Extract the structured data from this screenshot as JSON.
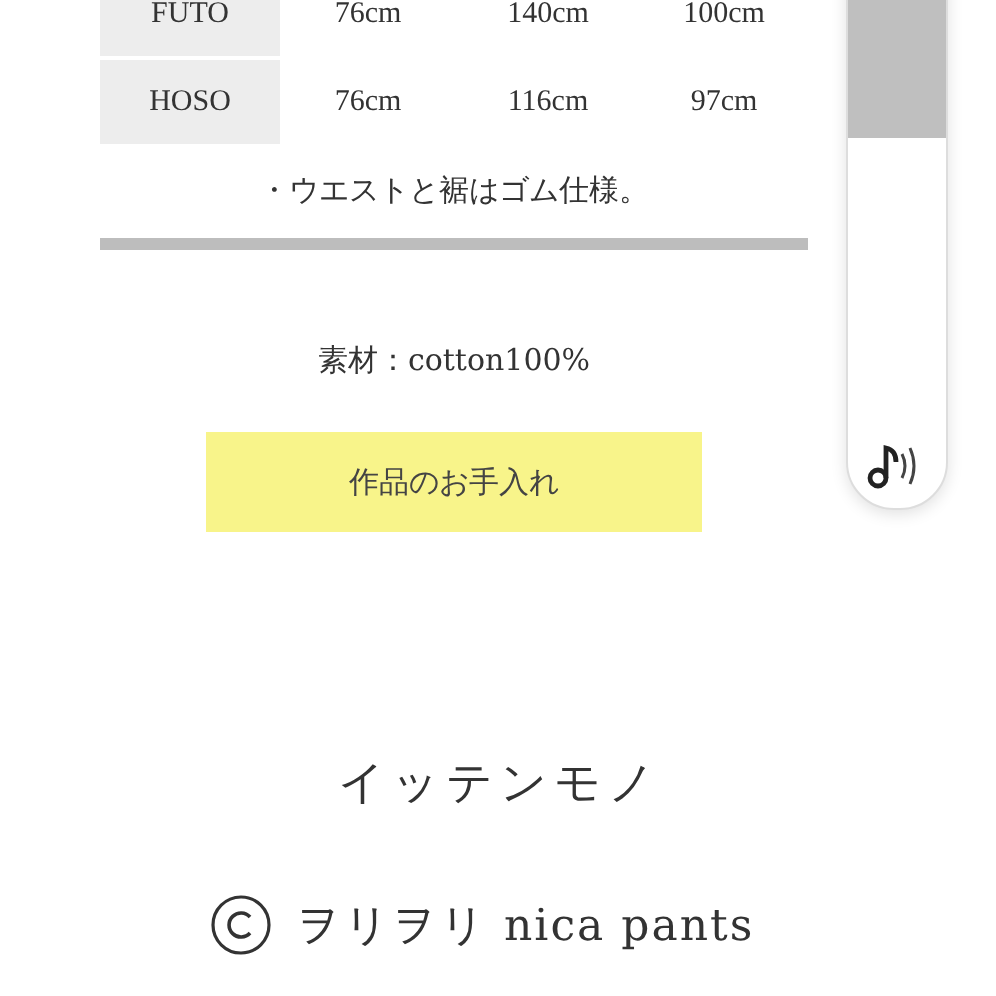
{
  "size_table": {
    "rows": [
      {
        "label": "FUTO",
        "cells": [
          "76cm",
          "140cm",
          "100cm"
        ]
      },
      {
        "label": "HOSO",
        "cells": [
          "76cm",
          "116cm",
          "97cm"
        ]
      }
    ]
  },
  "note": "・ウエストと裾はゴム仕様。",
  "material": "素材：cotton100%",
  "care_button": "作品のお手入れ",
  "shop_name": "イッテンモノ",
  "copyright": "ヲリヲリ nica pants"
}
